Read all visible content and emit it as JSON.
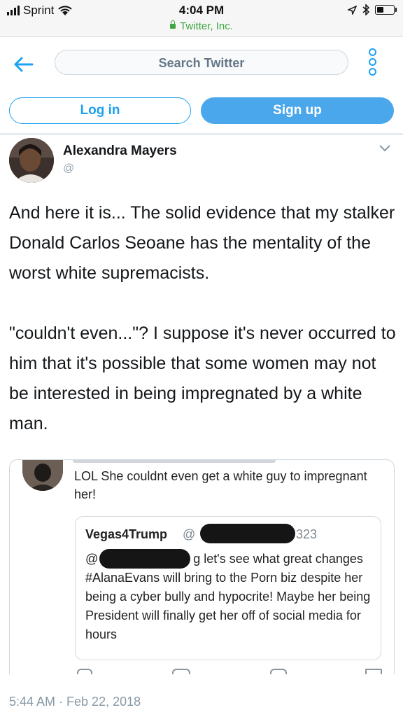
{
  "status_bar": {
    "carrier": "Sprint",
    "time": "4:04 PM",
    "site": "Twitter, Inc."
  },
  "header": {
    "search_placeholder": "Search Twitter",
    "login_label": "Log in",
    "signup_label": "Sign up"
  },
  "tweet": {
    "author_name": "Alexandra Mayers",
    "author_handle": "@",
    "paragraphs": [
      "And here it is... The solid evidence that my stalker Donald Carlos Seoane has the mentality of the worst white supremacists.",
      "\"couldn't even...\"? I suppose it's never occurred to him that it's possible that some women may not be interested in being impregnated by a white man."
    ],
    "timestamp": "5:44 AM · Feb 22, 2018"
  },
  "embedded_screenshot": {
    "reply_text": "LOL She couldnt even get a white guy to impregnant her!",
    "quoted": {
      "name": "Vegas4Trump",
      "handle_prefix": "@",
      "handle_suffix": "323",
      "text_prefix": "@",
      "text_body": "g let's see what great changes #AlanaEvans will bring to the Porn biz despite her being a cyber bully and hypocrite!  Maybe her being President will finally get her off of social media for hours"
    }
  },
  "colors": {
    "twitter_blue": "#1da1f2",
    "secure_green": "#3fa540"
  }
}
